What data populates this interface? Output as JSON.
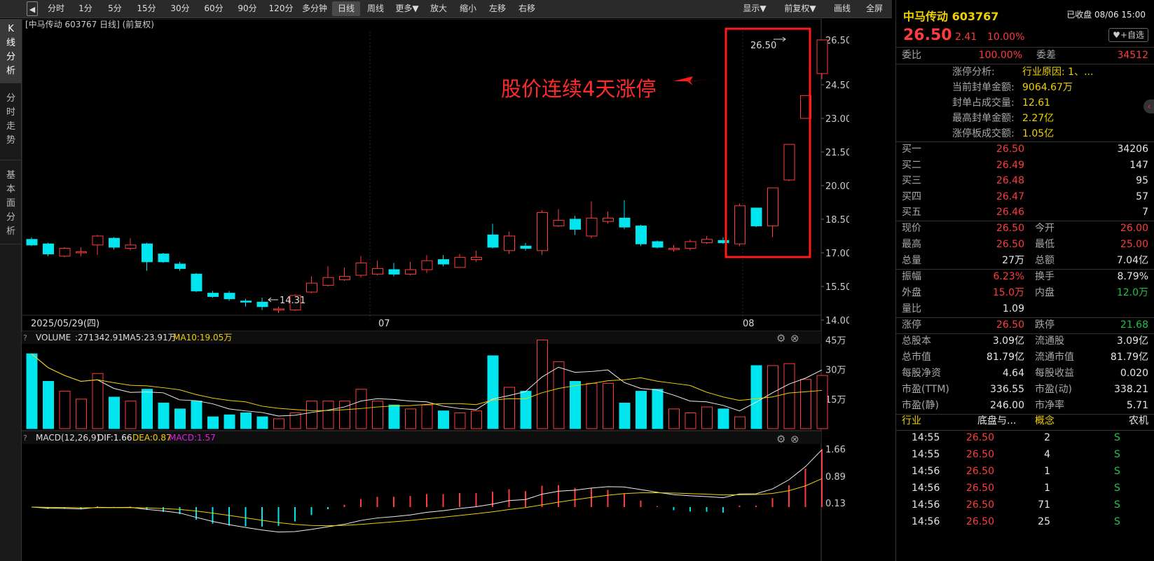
{
  "toolbar": {
    "back_icon": "back-arrow-icon",
    "periods": [
      "分时",
      "1分",
      "5分",
      "15分",
      "30分",
      "60分",
      "90分",
      "120分",
      "多分钟",
      "日线",
      "周线",
      "更多▼",
      "放大",
      "缩小",
      "左移",
      "右移"
    ],
    "active": "日线",
    "right": [
      "显示▼",
      "前复权▼",
      "画线",
      "全屏"
    ]
  },
  "side_tabs": [
    "K\n线\n分\n析",
    "分\n时\n走\n势",
    "基\n本\n面\n分\n析"
  ],
  "chart": {
    "title": "[中马传动 603767 日线] (前复权)",
    "y_ticks": [
      "26.50",
      "24.50",
      "23.00",
      "21.50",
      "20.00",
      "18.50",
      "17.00",
      "15.50",
      "14.00"
    ],
    "x_labels": [
      "2025/05/29(四)",
      "07",
      "08"
    ],
    "max_label": "26.50",
    "min_label": "14.31",
    "annotation": "股价连续4天涨停",
    "candle_colors": {
      "up": "#ff3b3b",
      "down": "#00e5ee"
    }
  },
  "chart_data": {
    "type": "candlestick",
    "candles": [
      [
        17.6,
        17.35,
        17.7,
        17.3
      ],
      [
        17.4,
        16.95,
        17.45,
        16.85
      ],
      [
        16.85,
        17.2,
        17.25,
        16.8
      ],
      [
        17.0,
        17.05,
        17.25,
        16.85
      ],
      [
        17.35,
        17.75,
        17.8,
        16.9
      ],
      [
        17.65,
        17.25,
        17.7,
        17.15
      ],
      [
        17.2,
        17.35,
        17.65,
        17.1
      ],
      [
        17.4,
        16.6,
        17.45,
        16.2
      ],
      [
        16.95,
        16.6,
        17.0,
        16.55
      ],
      [
        16.5,
        16.3,
        16.6,
        16.2
      ],
      [
        16.05,
        15.3,
        16.1,
        15.25
      ],
      [
        15.2,
        15.05,
        15.3,
        15.0
      ],
      [
        15.2,
        14.95,
        15.3,
        14.85
      ],
      [
        14.85,
        14.8,
        14.95,
        14.6
      ],
      [
        14.8,
        14.6,
        15.0,
        14.45
      ],
      [
        14.45,
        14.5,
        14.6,
        14.31
      ],
      [
        14.45,
        15.1,
        15.15,
        14.4
      ],
      [
        15.25,
        15.65,
        15.95,
        15.2
      ],
      [
        15.55,
        15.9,
        16.4,
        15.5
      ],
      [
        15.8,
        15.95,
        16.35,
        15.75
      ],
      [
        16.0,
        16.55,
        16.85,
        15.9
      ],
      [
        16.05,
        16.3,
        16.65,
        16.0
      ],
      [
        16.25,
        16.05,
        16.55,
        15.95
      ],
      [
        16.05,
        16.25,
        16.6,
        16.0
      ],
      [
        16.25,
        16.65,
        16.9,
        16.1
      ],
      [
        16.7,
        16.5,
        16.9,
        16.4
      ],
      [
        16.35,
        16.8,
        16.95,
        16.35
      ],
      [
        16.7,
        16.8,
        17.1,
        16.6
      ],
      [
        17.8,
        17.25,
        18.3,
        17.2
      ],
      [
        17.1,
        17.75,
        17.95,
        16.95
      ],
      [
        17.3,
        17.2,
        17.45,
        17.1
      ],
      [
        17.1,
        18.8,
        18.9,
        16.9
      ],
      [
        18.2,
        18.45,
        18.95,
        18.15
      ],
      [
        18.5,
        18.05,
        18.65,
        17.8
      ],
      [
        17.75,
        18.55,
        19.3,
        17.65
      ],
      [
        18.4,
        18.55,
        18.85,
        18.3
      ],
      [
        18.55,
        18.15,
        19.35,
        18.05
      ],
      [
        18.2,
        17.4,
        18.25,
        17.3
      ],
      [
        17.5,
        17.25,
        17.55,
        17.2
      ],
      [
        17.15,
        17.2,
        17.35,
        17.05
      ],
      [
        17.2,
        17.5,
        17.6,
        17.1
      ],
      [
        17.45,
        17.6,
        17.75,
        17.4
      ],
      [
        17.55,
        17.45,
        17.7,
        17.4
      ],
      [
        17.4,
        19.1,
        19.2,
        17.3
      ],
      [
        19.0,
        18.2,
        19.0,
        18.15
      ],
      [
        18.2,
        19.9,
        19.9,
        17.7
      ],
      [
        20.25,
        21.84,
        21.84,
        20.2
      ],
      [
        23.0,
        24.02,
        24.02,
        23.0
      ],
      [
        25.0,
        26.5,
        26.5,
        24.75
      ]
    ],
    "volume": {
      "label": "VOLUME",
      "value": "271342.91",
      "ma5": "MA5:23.91万",
      "ma10": "MA10:19.05万",
      "y_ticks": [
        "45万",
        "30万",
        "15万"
      ],
      "bars": [
        38,
        24,
        19,
        15,
        28,
        16,
        14,
        20,
        13,
        10,
        14,
        6,
        7,
        8,
        6,
        5,
        8,
        14,
        14,
        14,
        20,
        14,
        12,
        10,
        12,
        9,
        8,
        9,
        37,
        21,
        19,
        45,
        34,
        24,
        23,
        23,
        13,
        19,
        20,
        10,
        8,
        11,
        10,
        6,
        32,
        32,
        33,
        25,
        27
      ]
    },
    "macd": {
      "label": "MACD(12,26,9)",
      "dif": "DIF:1.66",
      "dea": "DEA:0.87",
      "macd": "MACD:1.57",
      "y_ticks": [
        "1.66",
        "0.89",
        "0.13"
      ]
    }
  },
  "panel": {
    "stock": "中马传动 603767",
    "status": "已收盘 08/06 15:00",
    "price": "26.50",
    "change": "2.41",
    "pct": "10.00%",
    "watch_icon": "heart-icon",
    "watch_label": "+自选",
    "wei_bi": {
      "l": "委比",
      "v": "100.00%",
      "l2": "委差",
      "v2": "34512"
    },
    "limit_analysis": [
      [
        "涨停分析:",
        "行业原因: 1、..."
      ],
      [
        "当前封单金额:",
        "9064.67万"
      ],
      [
        "封单占成交量:",
        "12.61"
      ],
      [
        "最高封单金额:",
        "2.27亿"
      ],
      [
        "涨停板成交额:",
        "1.05亿"
      ]
    ],
    "bids": [
      [
        "买一",
        "26.50",
        "34206"
      ],
      [
        "买二",
        "26.49",
        "147"
      ],
      [
        "买三",
        "26.48",
        "95"
      ],
      [
        "买四",
        "26.47",
        "57"
      ],
      [
        "买五",
        "26.46",
        "7"
      ]
    ],
    "quote": [
      [
        "现价",
        "26.50",
        "今开",
        "26.00"
      ],
      [
        "最高",
        "26.50",
        "最低",
        "25.00"
      ],
      [
        "总量",
        "27万",
        "总额",
        "7.04亿"
      ]
    ],
    "stats": [
      [
        "振幅",
        "6.23%",
        "换手",
        "8.79%"
      ],
      [
        "外盘",
        "15.0万",
        "内盘",
        "12.0万"
      ]
    ],
    "liangbi": [
      "量比",
      "1.09"
    ],
    "limits": [
      "涨停",
      "26.50",
      "跌停",
      "21.68"
    ],
    "fund": [
      [
        "总股本",
        "3.09亿",
        "流通股",
        "3.09亿"
      ],
      [
        "总市值",
        "81.79亿",
        "流通市值",
        "81.79亿"
      ],
      [
        "每股净资",
        "4.64",
        "每股收益",
        "0.020"
      ],
      [
        "市盈(TTM)",
        "336.55",
        "市盈(动)",
        "338.21"
      ],
      [
        "市盈(静)",
        "246.00",
        "市净率",
        "5.71"
      ]
    ],
    "industry": [
      "行业",
      "底盘与...",
      "概念",
      "农机"
    ],
    "trades": [
      [
        "14:55",
        "26.50",
        "2",
        "S"
      ],
      [
        "14:55",
        "26.50",
        "4",
        "S"
      ],
      [
        "14:56",
        "26.50",
        "1",
        "S"
      ],
      [
        "14:56",
        "26.50",
        "1",
        "S"
      ],
      [
        "14:56",
        "26.50",
        "71",
        "S"
      ],
      [
        "14:56",
        "26.50",
        "25",
        "S"
      ]
    ]
  }
}
